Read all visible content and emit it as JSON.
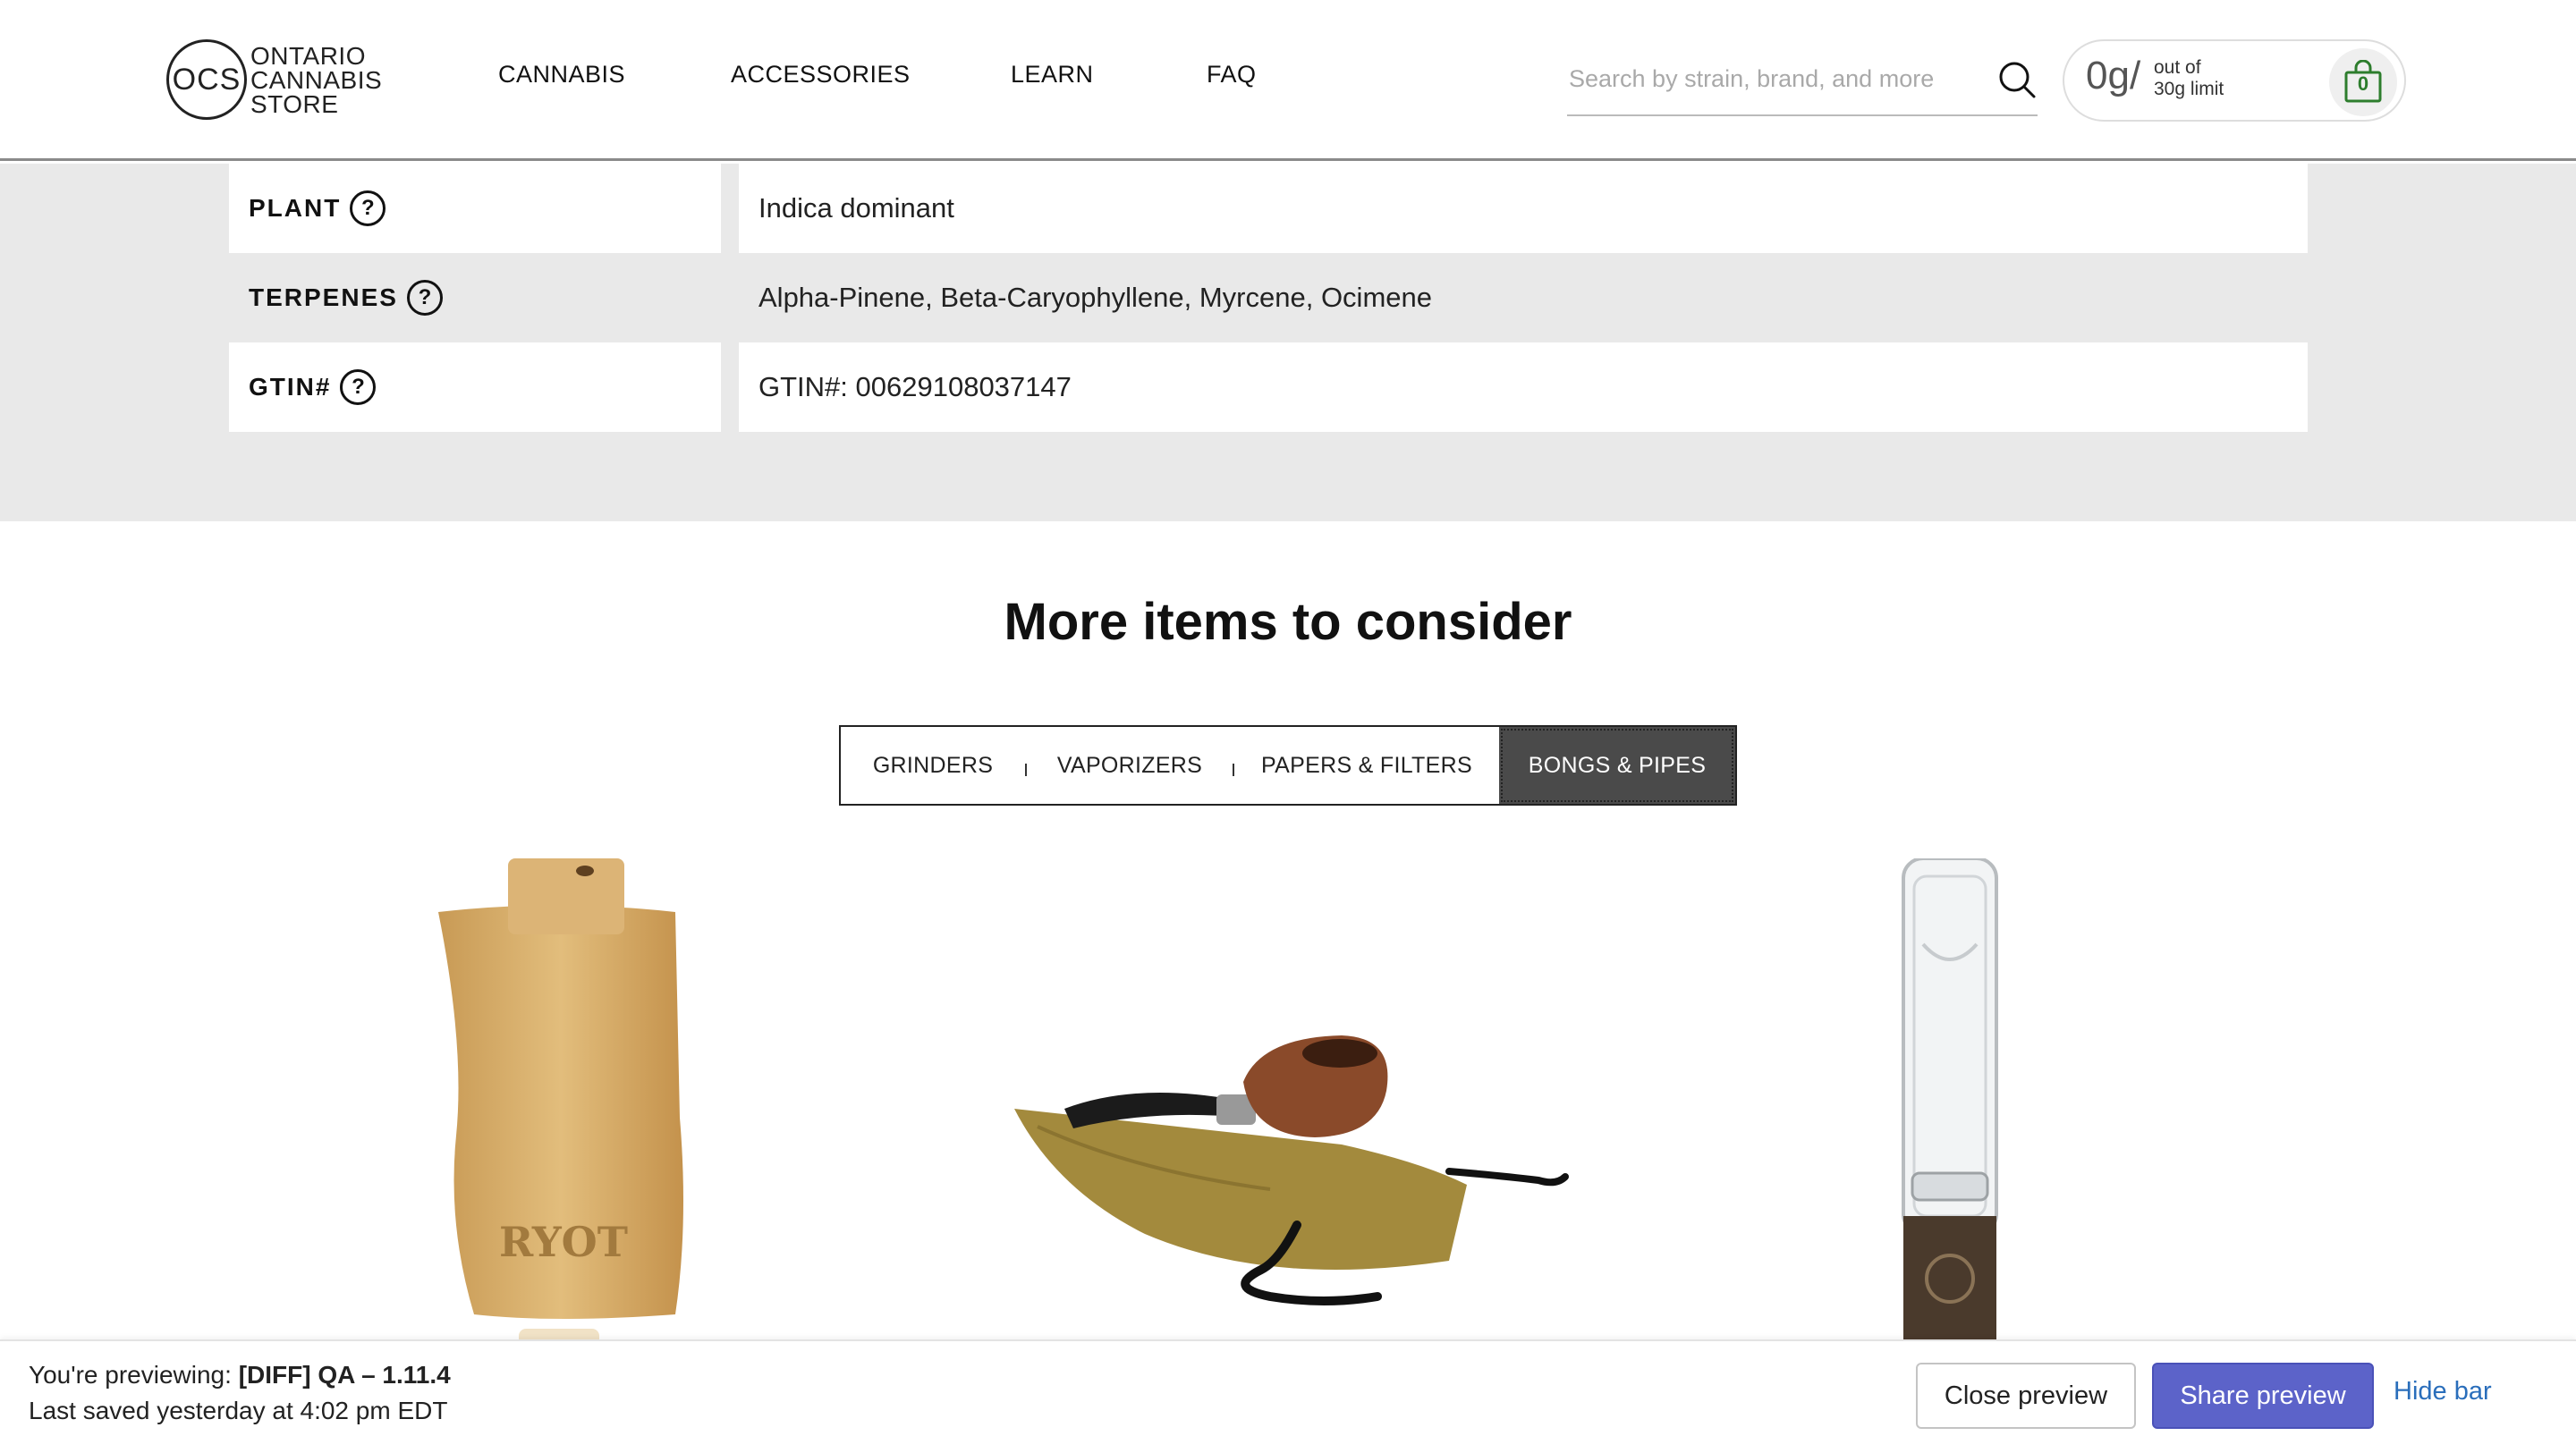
{
  "header": {
    "logo": {
      "mark": "OCS",
      "lines": [
        "ONTARIO",
        "CANNABIS",
        "STORE"
      ]
    },
    "nav": [
      {
        "label": "CANNABIS"
      },
      {
        "label": "ACCESSORIES"
      },
      {
        "label": "LEARN"
      },
      {
        "label": "FAQ"
      }
    ],
    "search": {
      "placeholder": "Search by strain, brand, and more",
      "value": "",
      "icon": "search-icon"
    },
    "limit": {
      "amount": "0g",
      "separator": "/",
      "sub_line1": "out of",
      "sub_line2": "30g limit",
      "cart_count": "0",
      "cart_icon": "shopping-bag-icon"
    }
  },
  "specs": [
    {
      "label": "PLANT",
      "value": "Indica dominant"
    },
    {
      "label": "TERPENES",
      "value": "Alpha-Pinene, Beta-Caryophyllene, Myrcene, Ocimene"
    },
    {
      "label": "GTIN#",
      "value": "GTIN#: 00629108037147"
    }
  ],
  "help_icon_glyph": "?",
  "more_items": {
    "title": "More items to consider",
    "tabs": [
      {
        "label": "GRINDERS",
        "active": false
      },
      {
        "label": "VAPORIZERS",
        "active": false
      },
      {
        "label": "PAPERS & FILTERS",
        "active": false
      },
      {
        "label": "BONGS & PIPES",
        "active": true
      }
    ],
    "products": [
      {
        "image": "wooden-dugout-box",
        "brand_engraving": "RYOT"
      },
      {
        "image": "wooden-tobacco-pipe-with-pouch"
      },
      {
        "image": "glass-chillum-pipe"
      }
    ]
  },
  "preview_bar": {
    "prefix": "You're previewing:",
    "theme_name": "[DIFF] QA – 1.11.4",
    "saved": "Last saved yesterday at 4:02 pm EDT",
    "close_label": "Close preview",
    "share_label": "Share preview",
    "hide_label": "Hide bar"
  },
  "colors": {
    "spec_background": "#e9e9e9",
    "tab_active_bg": "#4a4a4a",
    "share_button": "#5c63c9",
    "hide_link": "#2a6ebb",
    "cart_count": "#2d7d2d"
  }
}
